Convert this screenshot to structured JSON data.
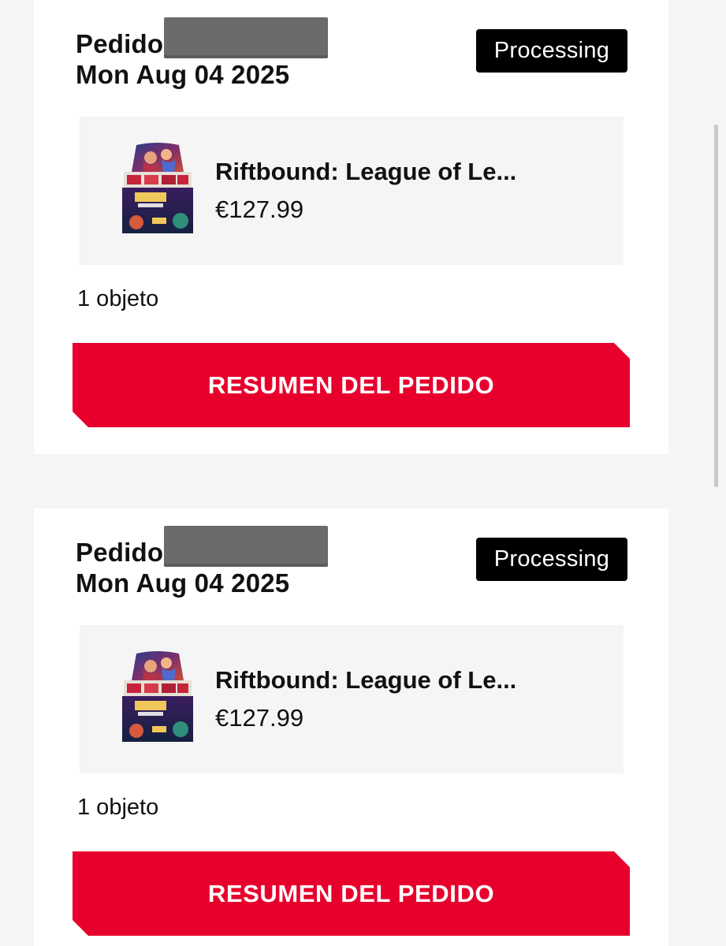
{
  "orders": [
    {
      "label": "Pedido",
      "date": "Mon Aug 04 2025",
      "status": "Processing",
      "product": {
        "name": "Riftbound: League of Le...",
        "price": "€127.99"
      },
      "item_count": "1 objeto",
      "button_label": "RESUMEN DEL PEDIDO"
    },
    {
      "label": "Pedido",
      "date": "Mon Aug 04 2025",
      "status": "Processing",
      "product": {
        "name": "Riftbound: League of Le...",
        "price": "€127.99"
      },
      "item_count": "1 objeto",
      "button_label": "RESUMEN DEL PEDIDO"
    }
  ],
  "colors": {
    "accent": "#e8002d",
    "status_badge": "#000000",
    "page_background": "#f5f5f5",
    "card_background": "#ffffff"
  },
  "icons": {
    "product_image": "product-box-thumbnail"
  }
}
